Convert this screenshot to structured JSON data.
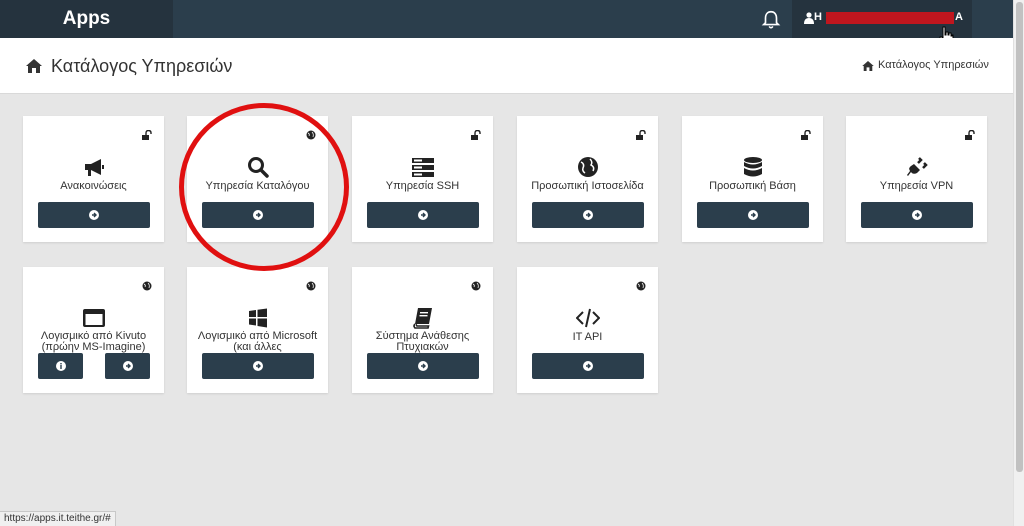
{
  "topbar": {
    "brand": "Apps",
    "user_initial": "H",
    "user_final": "A"
  },
  "header": {
    "title": "Κατάλογος Υπηρεσιών",
    "breadcrumb": "Κατάλογος Υπηρεσιών"
  },
  "cards": [
    {
      "label": "Ανακοινώσεις",
      "icon": "bullhorn-icon",
      "badge": "unlock-icon"
    },
    {
      "label": "Υπηρεσία Καταλόγου",
      "icon": "search-icon",
      "badge": "globe-icon"
    },
    {
      "label": "Υπηρεσία SSH",
      "icon": "server-icon",
      "badge": "unlock-icon"
    },
    {
      "label": "Προσωπική Ιστοσελίδα",
      "icon": "globe-icon",
      "badge": "unlock-icon"
    },
    {
      "label": "Προσωπική Βάση",
      "icon": "database-icon",
      "badge": "unlock-icon"
    },
    {
      "label": "Υπηρεσία VPN",
      "icon": "plug-icon",
      "badge": "unlock-icon"
    },
    {
      "label": "Λογισμικό από Kivuto (πρώην MS-Imagine)",
      "icon": "window-icon",
      "badge": "globe-icon"
    },
    {
      "label": "Λογισμικό από Microsoft (και άλλες",
      "icon": "windows-icon",
      "badge": "globe-icon"
    },
    {
      "label": "Σύστημα Ανάθεσης Πτυχιακών",
      "icon": "book-icon",
      "badge": "globe-icon"
    },
    {
      "label": "IT API",
      "icon": "code-icon",
      "badge": "globe-icon"
    }
  ],
  "status_bar": {
    "url": "https://apps.it.teithe.gr/#"
  },
  "colors": {
    "topbar": "#2b3e4c",
    "button": "#2b3e4c",
    "annotation": "#e01010"
  }
}
